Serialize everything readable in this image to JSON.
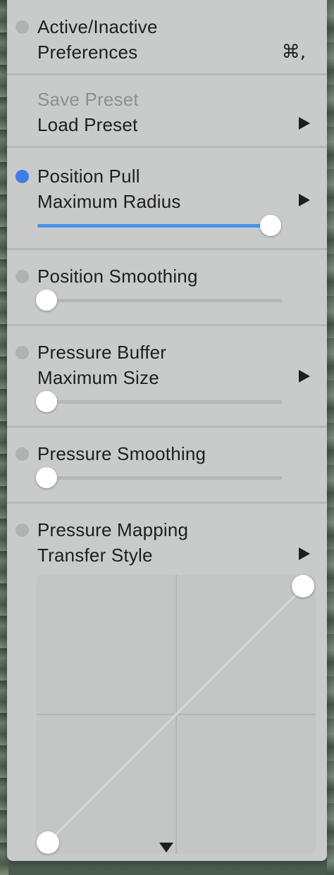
{
  "menu": {
    "section1": {
      "active_inactive": "Active/Inactive",
      "preferences": "Preferences",
      "preferences_shortcut": "⌘,"
    },
    "section2": {
      "save_preset": "Save Preset",
      "load_preset": "Load Preset"
    },
    "position_pull": {
      "title": "Position Pull",
      "submenu": "Maximum Radius",
      "enabled": true,
      "slider_value": 1.0
    },
    "position_smoothing": {
      "title": "Position Smoothing",
      "enabled": false,
      "slider_value": 0.0
    },
    "pressure_buffer": {
      "title": "Pressure Buffer",
      "submenu": "Maximum Size",
      "enabled": false,
      "slider_value": 0.0
    },
    "pressure_smoothing": {
      "title": "Pressure Smoothing",
      "enabled": false,
      "slider_value": 0.0
    },
    "pressure_mapping": {
      "title": "Pressure Mapping",
      "submenu": "Transfer Style",
      "enabled": false,
      "curve_start": [
        0,
        0
      ],
      "curve_end": [
        1,
        1
      ]
    }
  },
  "icons": {
    "submenu": "triangle-right-icon",
    "scroll_down": "triangle-down-icon"
  },
  "colors": {
    "accent": "#3d7ee6",
    "slider_fill": "#4b92ea",
    "menu_background": "#c9cbcb"
  }
}
